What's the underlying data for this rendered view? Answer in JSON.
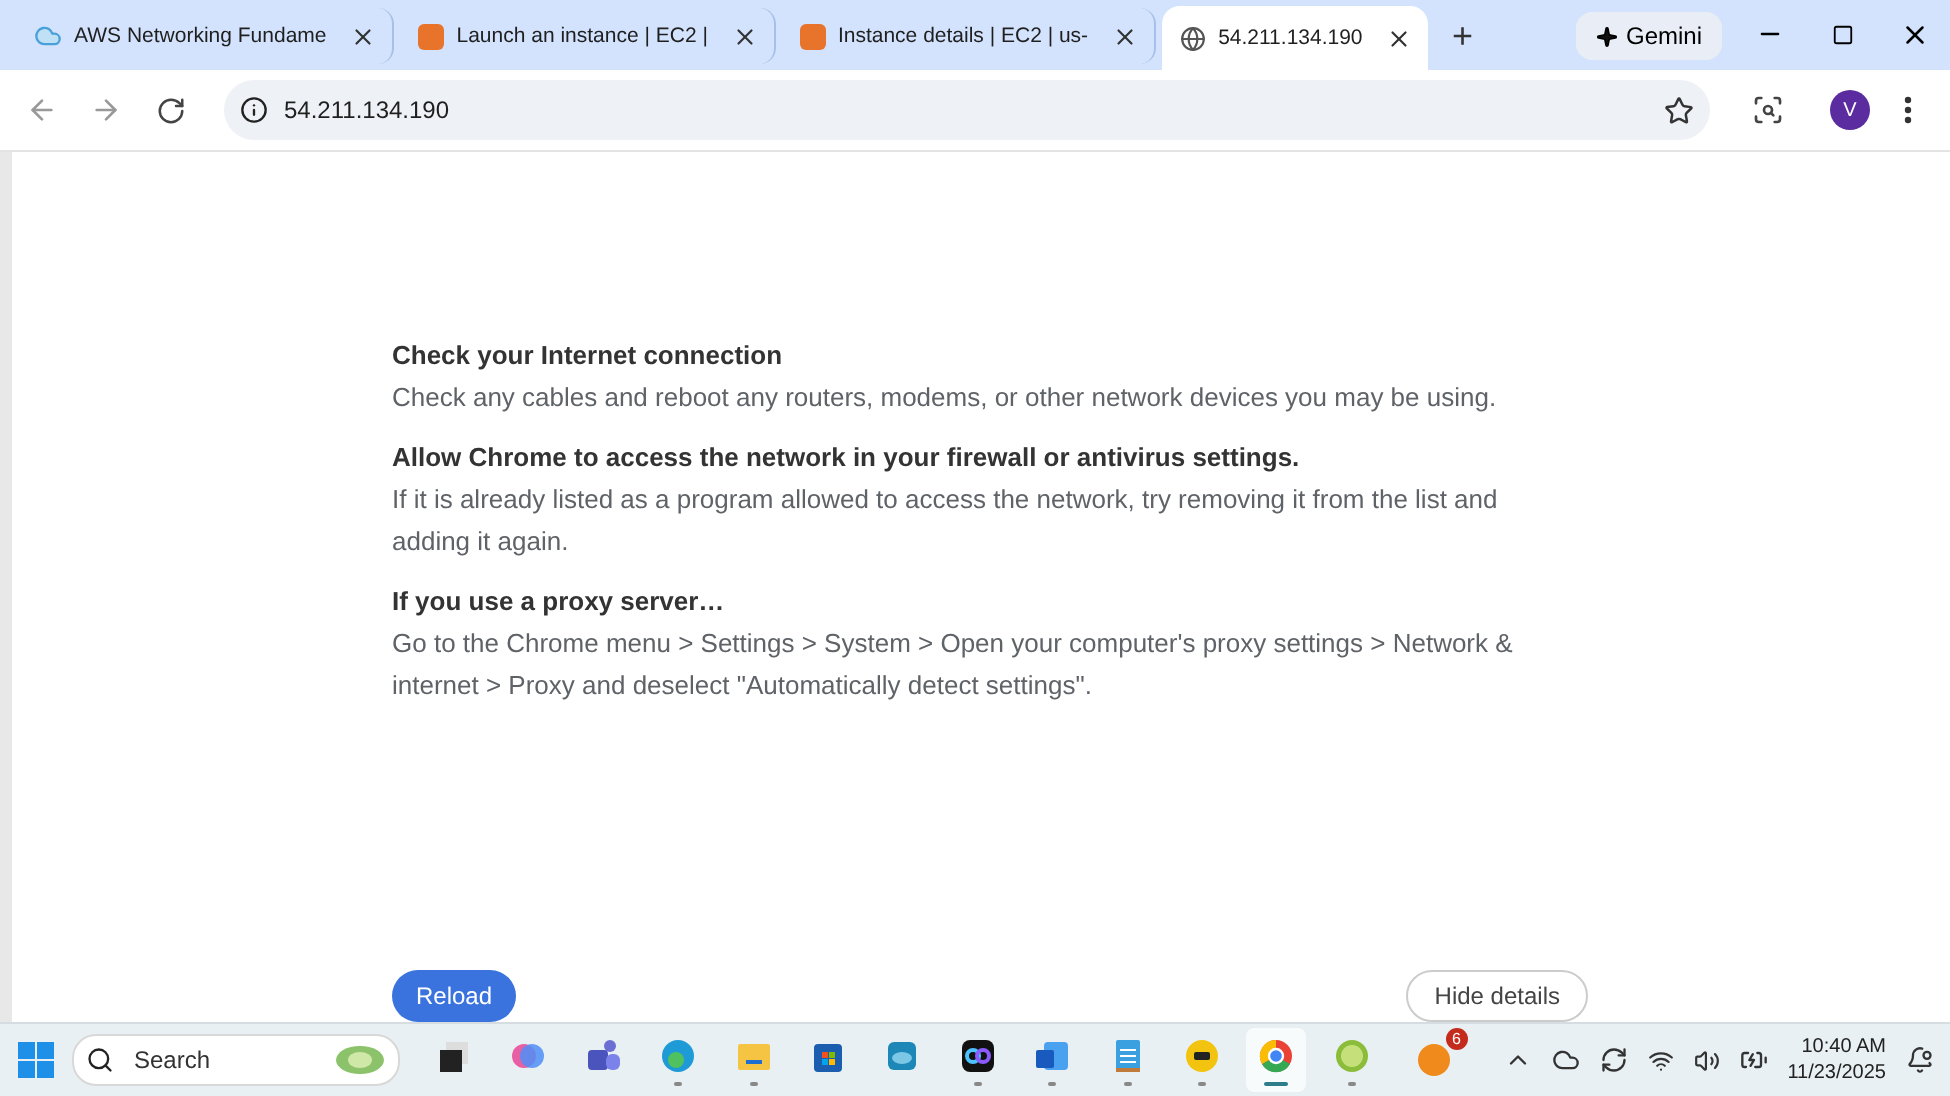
{
  "tabs": [
    {
      "title": "AWS Networking Fundame",
      "kind": "cloud",
      "selected": false
    },
    {
      "title": "Launch an instance | EC2 |",
      "kind": "orange",
      "selected": false
    },
    {
      "title": "Instance details | EC2 | us-",
      "kind": "orange",
      "selected": false
    },
    {
      "title": "54.211.134.190",
      "kind": "globe",
      "selected": true
    }
  ],
  "new_tab": "+",
  "gemini": "Gemini",
  "address": "54.211.134.190",
  "profile": "V",
  "sections": [
    {
      "heading": "Check your Internet connection",
      "body": "Check any cables and reboot any routers, modems, or other network devices you may be using."
    },
    {
      "heading": "Allow Chrome to access the network in your firewall or antivirus settings.",
      "body": "If it is already listed as a program allowed to access the network, try removing it from the list and adding it again."
    },
    {
      "heading": "If you use a proxy server…",
      "body": "Go to the Chrome menu > Settings > System > Open your computer's proxy settings > Network & internet > Proxy and deselect \"Automatically detect settings\"."
    }
  ],
  "reload_button": "Reload",
  "details_button": "Hide details",
  "taskbar": {
    "search_placeholder": "Search",
    "apps": [
      {
        "kind": "taskview",
        "running": false,
        "selected": false
      },
      {
        "kind": "copilot",
        "running": false,
        "selected": false
      },
      {
        "kind": "teams",
        "running": false,
        "selected": false
      },
      {
        "kind": "edge",
        "running": true,
        "selected": false
      },
      {
        "kind": "folder",
        "running": true,
        "selected": false
      },
      {
        "kind": "store",
        "running": false,
        "selected": false
      },
      {
        "kind": "cloud",
        "running": false,
        "selected": false
      },
      {
        "kind": "webex",
        "running": true,
        "selected": false
      },
      {
        "kind": "word",
        "running": true,
        "selected": false
      },
      {
        "kind": "notepad",
        "running": true,
        "selected": false
      },
      {
        "kind": "ue",
        "running": true,
        "selected": false
      },
      {
        "kind": "chrome",
        "running": true,
        "selected": true
      },
      {
        "kind": "wapp",
        "running": true,
        "selected": false
      }
    ],
    "notification_count": "6",
    "time": "10:40 AM",
    "date": "11/23/2025"
  }
}
